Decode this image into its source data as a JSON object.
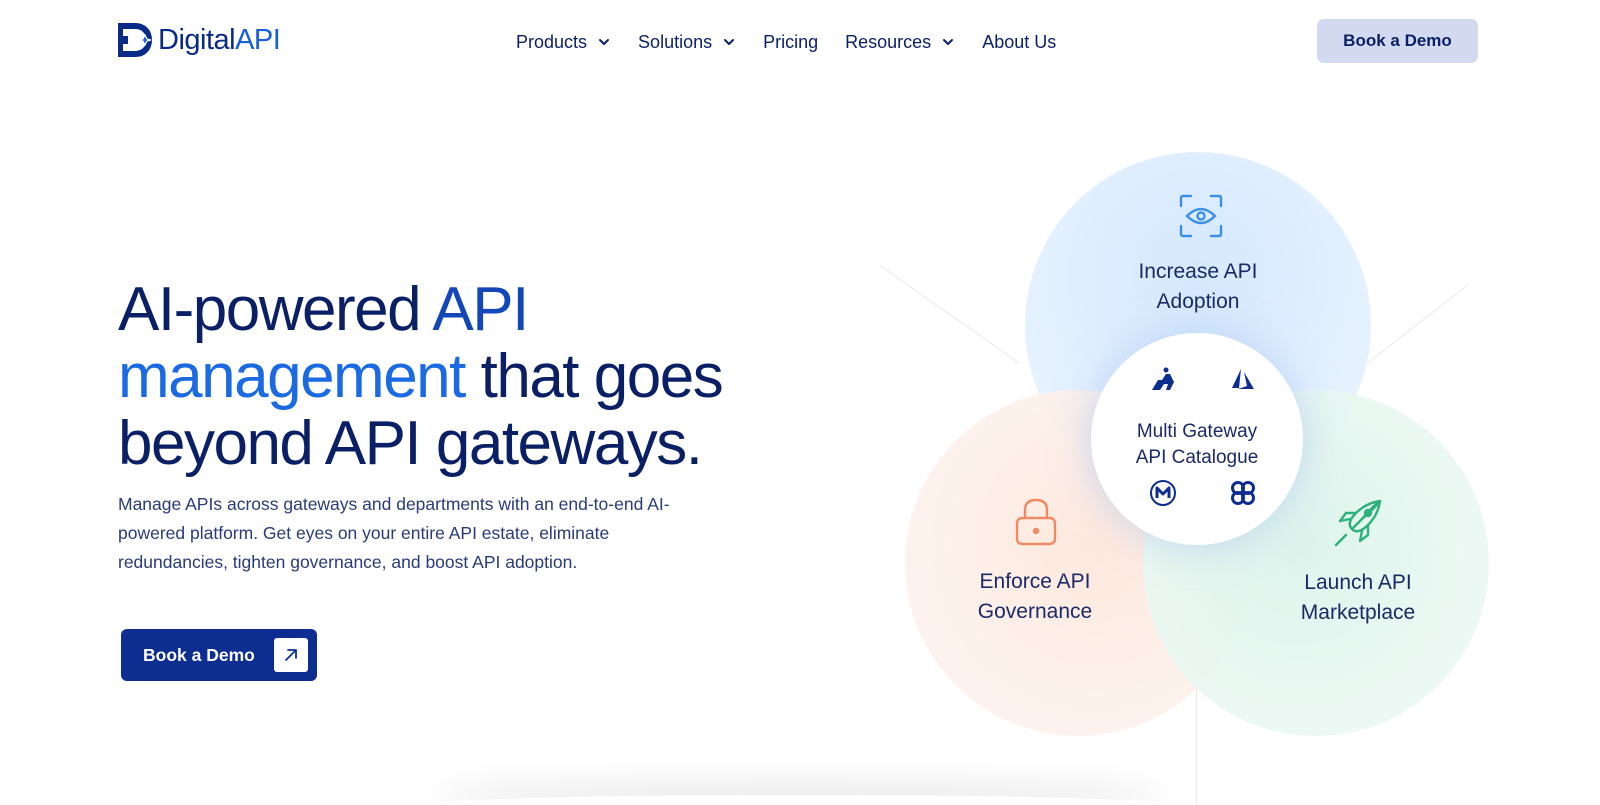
{
  "brand": {
    "name_part1": "Digital",
    "name_part2": "API"
  },
  "nav": {
    "items": [
      {
        "label": "Products",
        "has_dropdown": true
      },
      {
        "label": "Solutions",
        "has_dropdown": true
      },
      {
        "label": "Pricing",
        "has_dropdown": false
      },
      {
        "label": "Resources",
        "has_dropdown": true
      },
      {
        "label": "About Us",
        "has_dropdown": false
      }
    ],
    "cta": "Book a Demo"
  },
  "hero": {
    "title_part1": "AI-powered ",
    "title_part2": "API",
    "title_part3": "management",
    "title_part4": " that goes",
    "title_part5": "beyond API gateways.",
    "description": "Manage APIs across gateways and departments with an end-to-end AI-powered platform. Get eyes on your entire API estate, eliminate redundancies, tighten governance, and boost API adoption.",
    "cta": "Book a Demo"
  },
  "diagram": {
    "top": {
      "line1": "Increase API",
      "line2": "Adoption",
      "icon": "eye-scan-icon"
    },
    "left": {
      "line1": "Enforce API",
      "line2": "Governance",
      "icon": "lock-icon"
    },
    "right": {
      "line1": "Launch API",
      "line2": "Marketplace",
      "icon": "rocket-icon"
    },
    "center": {
      "line1": "Multi Gateway",
      "line2": "API Catalogue"
    },
    "gateway_icons": [
      "kong-icon",
      "azure-icon",
      "mulesoft-icon",
      "apigee-icon"
    ]
  },
  "colors": {
    "primary": "#0d2d91",
    "accent": "#1a6ae3",
    "nav_cta_bg": "#d3daf0",
    "text_dark": "#0b1f66"
  }
}
